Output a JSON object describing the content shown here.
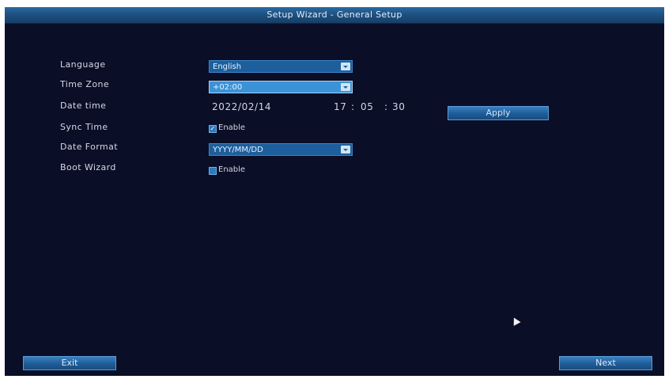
{
  "window": {
    "title": "Setup Wizard - General Setup"
  },
  "form": {
    "language": {
      "label": "Language",
      "value": "English"
    },
    "time_zone": {
      "label": "Time Zone",
      "value": "+02:00"
    },
    "date_time": {
      "label": "Date time",
      "date": "2022/02/14",
      "time_hour": "17",
      "time_minute": "05",
      "time_second": "30",
      "time_separator": ":",
      "apply_label": "Apply"
    },
    "sync_time": {
      "label": "Sync Time",
      "checked": true,
      "check_label": "Enable"
    },
    "date_format": {
      "label": "Date Format",
      "value": "YYYY/MM/DD"
    },
    "boot_wizard": {
      "label": "Boot Wizard",
      "checked": false,
      "check_label": "Enable"
    }
  },
  "footer": {
    "exit_label": "Exit",
    "next_label": "Next"
  },
  "colors": {
    "background": "#0a0e26",
    "title_bar": "#1d4f80",
    "dropdown": "#1c5f9c",
    "dropdown_highlight": "#3a93d8",
    "button": "#1f5c98",
    "text": "#d4d8e4"
  },
  "icons": {
    "dropdown_arrow": "chevron-down-icon",
    "checkbox_checked": "checkmark-icon",
    "cursor": "mouse-pointer-icon"
  }
}
